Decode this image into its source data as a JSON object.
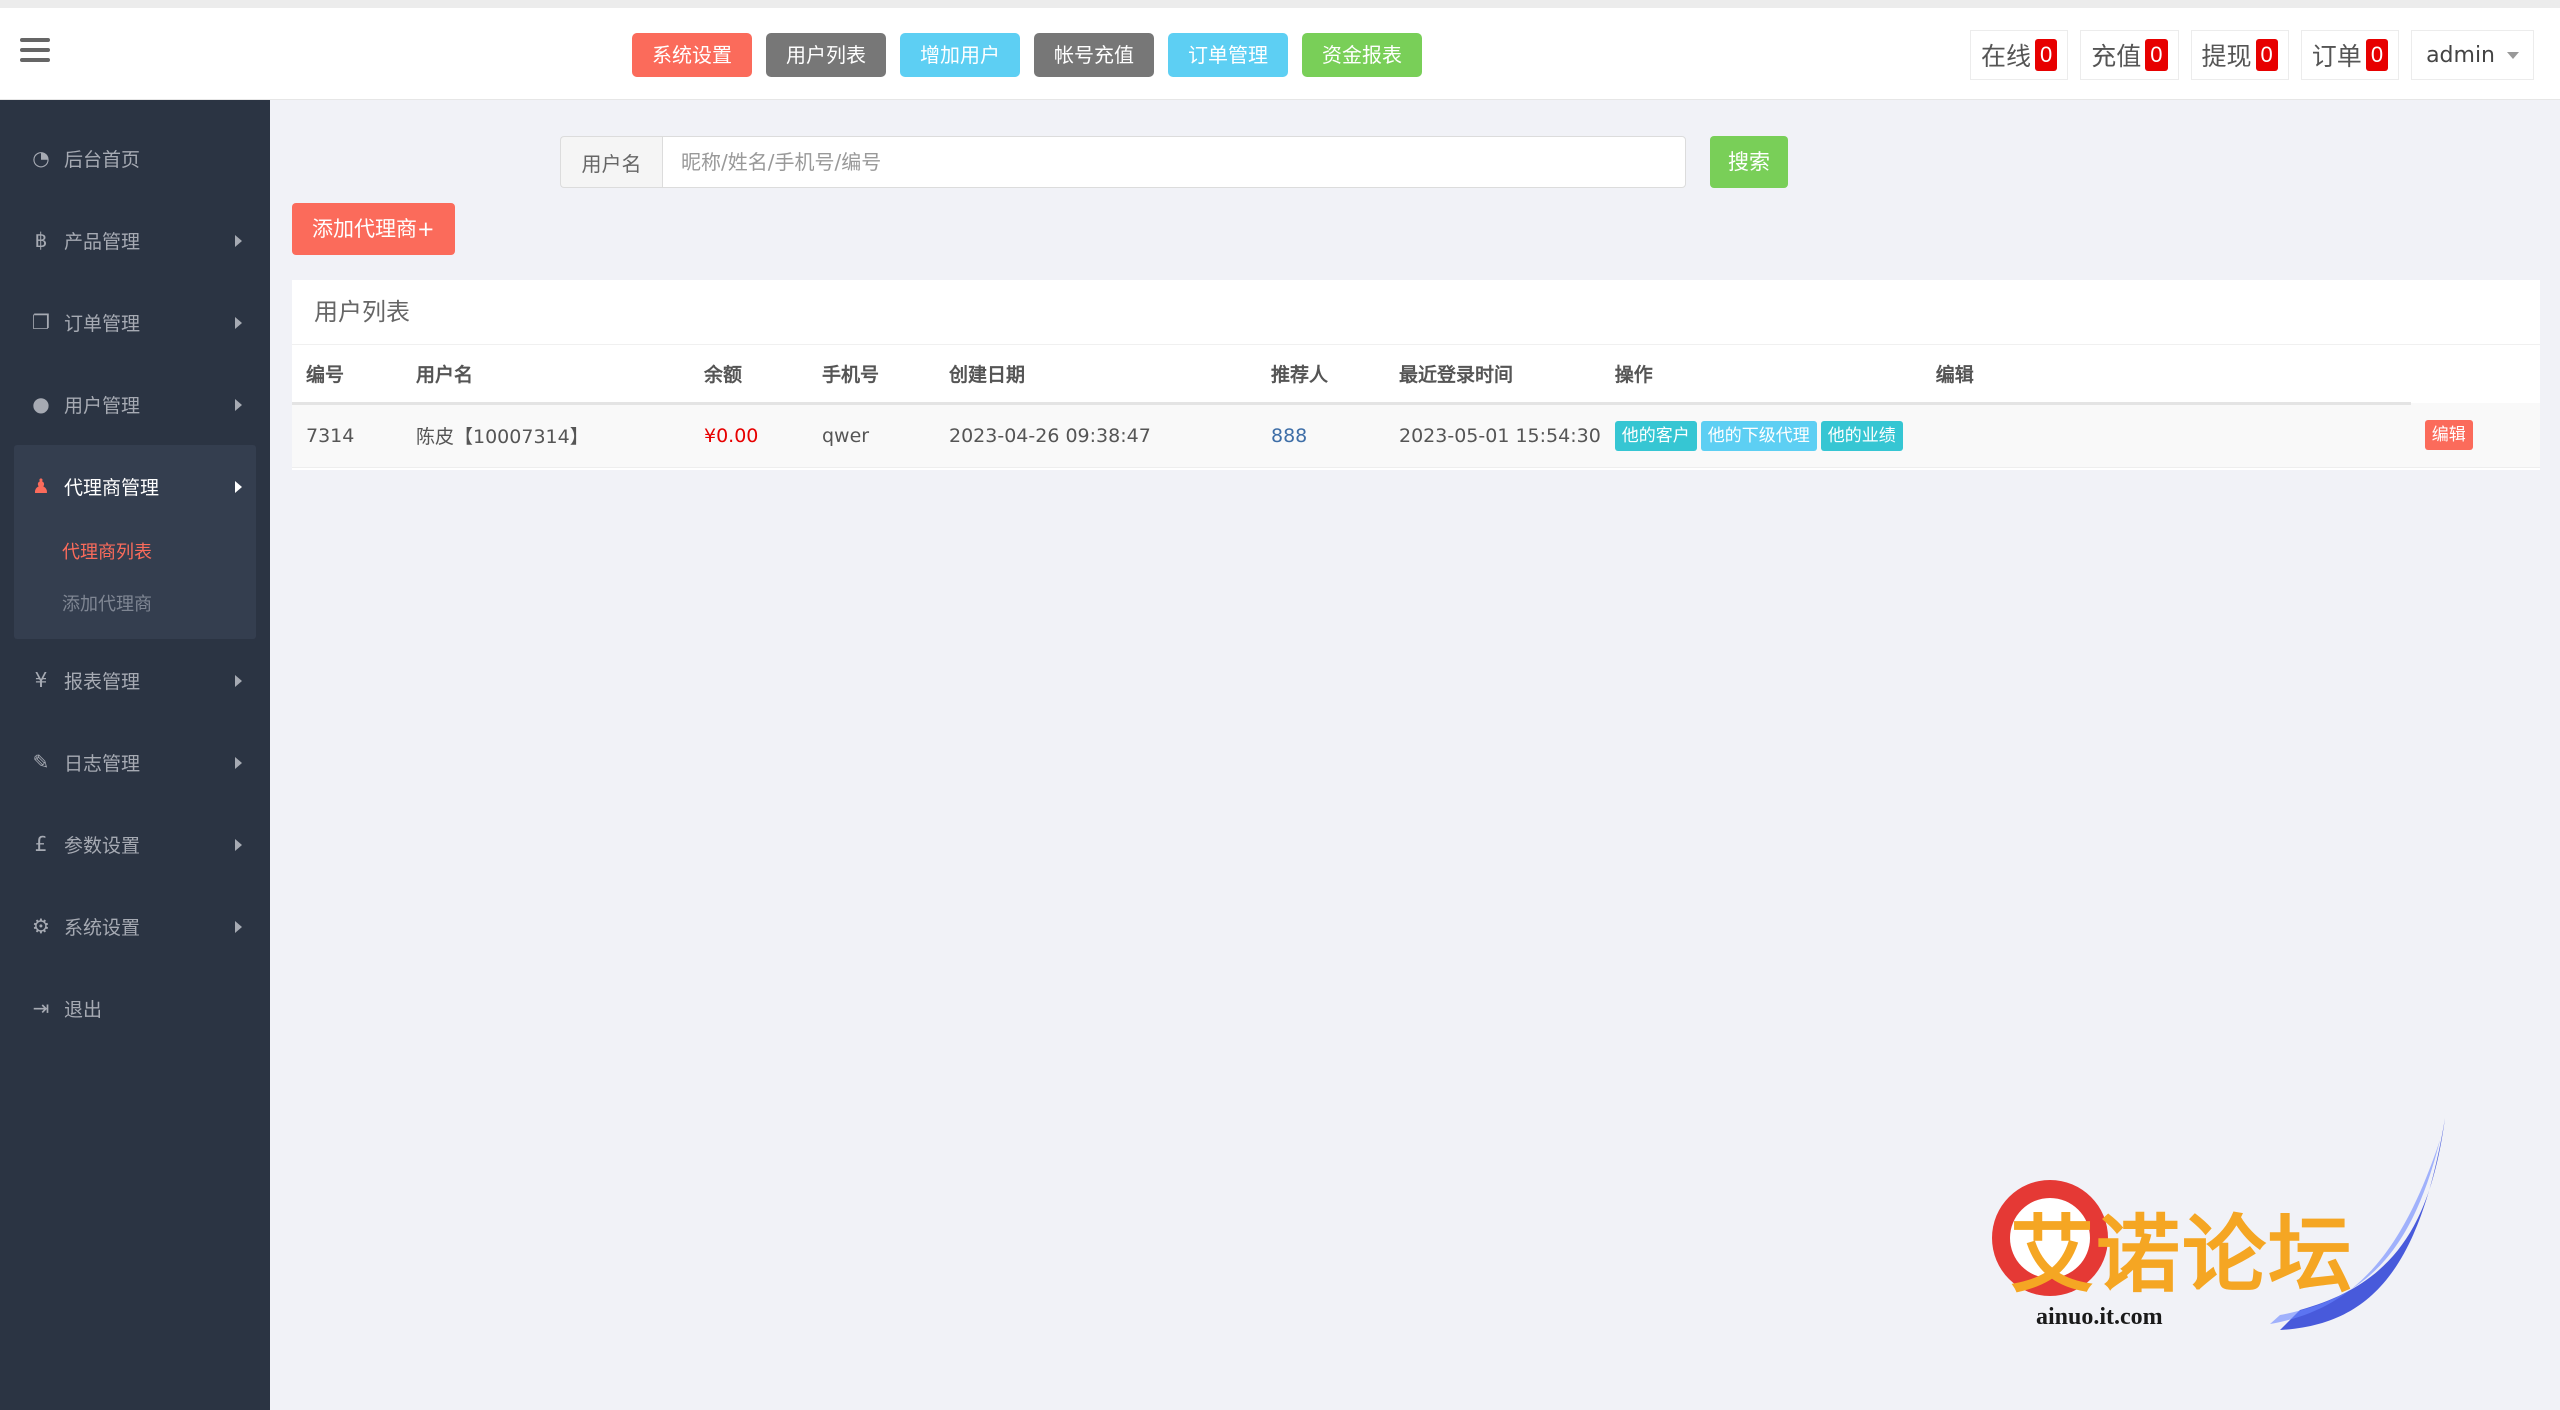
{
  "header": {
    "nav": [
      {
        "label": "系统设置",
        "color": "#fb6b5b"
      },
      {
        "label": "用户列表",
        "color": "#777777"
      },
      {
        "label": "增加用户",
        "color": "#5dcff3"
      },
      {
        "label": "帐号充值",
        "color": "#777777"
      },
      {
        "label": "订单管理",
        "color": "#5dcff3"
      },
      {
        "label": "资金报表",
        "color": "#79cf58"
      }
    ],
    "stats": [
      {
        "label": "在线",
        "value": "0"
      },
      {
        "label": "充值",
        "value": "0"
      },
      {
        "label": "提现",
        "value": "0"
      },
      {
        "label": "订单",
        "value": "0"
      }
    ],
    "user": "admin"
  },
  "sidebar": {
    "items": [
      {
        "label": "后台首页",
        "icon": "dashboard-icon"
      },
      {
        "label": "产品管理",
        "icon": "bitcoin-icon"
      },
      {
        "label": "订单管理",
        "icon": "copy-icon"
      },
      {
        "label": "用户管理",
        "icon": "user-icon"
      },
      {
        "label": "代理商管理",
        "icon": "users-icon",
        "active": true
      },
      {
        "label": "报表管理",
        "icon": "yen-icon"
      },
      {
        "label": "日志管理",
        "icon": "ticket-icon"
      },
      {
        "label": "参数设置",
        "icon": "pound-icon"
      },
      {
        "label": "系统设置",
        "icon": "cogs-icon"
      },
      {
        "label": "退出",
        "icon": "sign-out-icon"
      }
    ],
    "sub": [
      {
        "label": "代理商列表",
        "active": true
      },
      {
        "label": "添加代理商",
        "active": false
      }
    ]
  },
  "search": {
    "label": "用户名",
    "placeholder": "昵称/姓名/手机号/编号",
    "button": "搜索"
  },
  "add_agent": "添加代理商+",
  "panel": {
    "title": "用户列表",
    "columns": [
      "编号",
      "用户名",
      "余额",
      "手机号",
      "创建日期",
      "推荐人",
      "最近登录时间",
      "操作",
      "编辑"
    ],
    "rows": [
      {
        "id": "7314",
        "username": "陈皮【10007314】",
        "balance": "¥0.00",
        "phone": "qwer",
        "created": "2023-04-26 09:38:47",
        "referrer": "888",
        "last_login": "2023-05-01 15:54:30",
        "actions": [
          "他的客户",
          "他的下级代理",
          "他的业绩"
        ],
        "edit": "编辑"
      }
    ]
  },
  "watermark": {
    "title": "艾诺论坛",
    "url": "ainuo.it.com"
  }
}
